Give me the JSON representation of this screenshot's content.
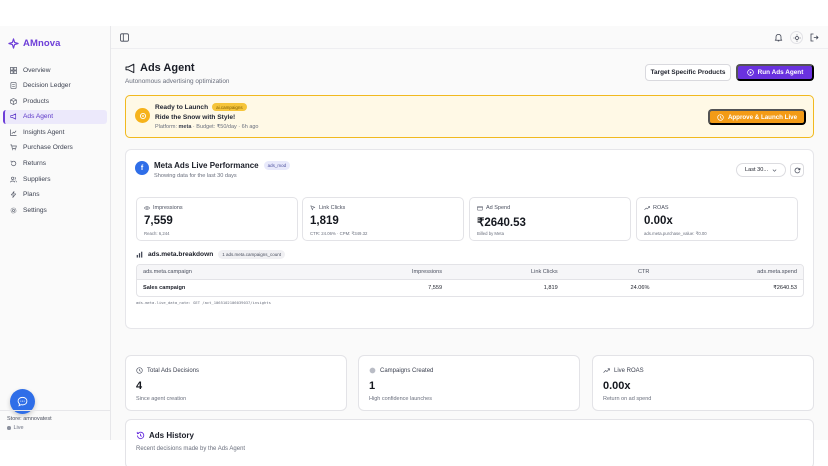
{
  "brand": {
    "name": "AMnova"
  },
  "sidebar": {
    "items": [
      {
        "label": "Overview",
        "icon": "grid-icon"
      },
      {
        "label": "Decision Ledger",
        "icon": "ledger-icon"
      },
      {
        "label": "Products",
        "icon": "box-icon"
      },
      {
        "label": "Ads Agent",
        "icon": "megaphone-icon",
        "active": true
      },
      {
        "label": "Insights Agent",
        "icon": "chart-icon"
      },
      {
        "label": "Purchase Orders",
        "icon": "cart-icon"
      },
      {
        "label": "Returns",
        "icon": "return-icon"
      },
      {
        "label": "Suppliers",
        "icon": "users-icon"
      },
      {
        "label": "Plans",
        "icon": "bolt-icon"
      },
      {
        "label": "Settings",
        "icon": "gear-icon"
      }
    ],
    "store_label": "Store: amnovatest",
    "status": "Live"
  },
  "header": {
    "title": "Ads Agent",
    "subtitle": "Autonomous advertising optimization",
    "target_button": "Target Specific Products",
    "run_button": "Run Ads Agent"
  },
  "launch": {
    "ready": "Ready to Launch",
    "tag": "ai.campaigns",
    "headline": "Ride the Snow with Style!",
    "platform_label": "Platform:",
    "platform": "meta",
    "budget_text": "· Budget: ₹50/day · 6h ago",
    "approve_button": "Approve & Launch Live"
  },
  "performance": {
    "icon_letter": "f",
    "title": "Meta Ads Live Performance",
    "badge": "ads_mod",
    "subtitle": "Showing data for the last 30 days",
    "period": "Last 30...",
    "metrics": [
      {
        "label": "Impressions",
        "value": "7,559",
        "sub": "Reach: 6,244",
        "icon": "eye-icon"
      },
      {
        "label": "Link Clicks",
        "value": "1,819",
        "sub": "CTR: 24.06% · CPM: ₹349.32",
        "icon": "cursor-icon"
      },
      {
        "label": "Ad Spend",
        "value": "₹2640.53",
        "sub": "Billed by Meta",
        "icon": "wallet-icon"
      },
      {
        "label": "ROAS",
        "value": "0.00x",
        "sub": "ads.meta.purchase_value: ₹0.00",
        "icon": "trend-icon"
      }
    ],
    "breakdown_title": "ads.meta.breakdown",
    "breakdown_count": "1 ads.meta.campaigns_count",
    "table": {
      "headers": [
        "ads.meta.campaign",
        "Impressions",
        "Link Clicks",
        "CTR",
        "ads.meta.spend"
      ],
      "rows": [
        [
          "Sales campaign",
          "7,559",
          "1,819",
          "24.06%",
          "₹2640.53"
        ]
      ]
    },
    "raw_note": "ads.meta.live_data_note: GET /act_1065102106039037/insights"
  },
  "stats": [
    {
      "label": "Total Ads Decisions",
      "value": "4",
      "sub": "Since agent creation",
      "icon": "history-icon"
    },
    {
      "label": "Campaigns Created",
      "value": "1",
      "sub": "High confidence launches",
      "icon": "circle-icon"
    },
    {
      "label": "Live ROAS",
      "value": "0.00x",
      "sub": "Return on ad spend",
      "icon": "trend-icon"
    }
  ],
  "history": {
    "title": "Ads History",
    "subtitle": "Recent decisions made by the Ads Agent"
  },
  "colors": {
    "accent": "#6a32df",
    "warning": "#f39b16",
    "meta_blue": "#2f6ee8"
  }
}
